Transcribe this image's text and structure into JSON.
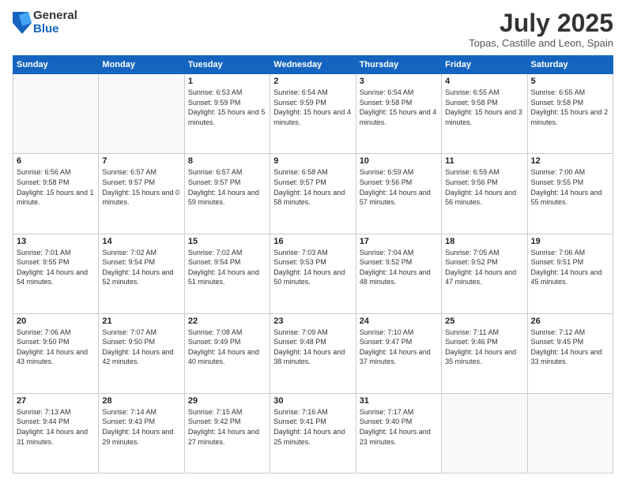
{
  "logo": {
    "general": "General",
    "blue": "Blue"
  },
  "header": {
    "month": "July 2025",
    "location": "Topas, Castille and Leon, Spain"
  },
  "weekdays": [
    "Sunday",
    "Monday",
    "Tuesday",
    "Wednesday",
    "Thursday",
    "Friday",
    "Saturday"
  ],
  "weeks": [
    [
      {
        "day": "",
        "content": ""
      },
      {
        "day": "",
        "content": ""
      },
      {
        "day": "1",
        "content": "Sunrise: 6:53 AM\nSunset: 9:59 PM\nDaylight: 15 hours and 5 minutes."
      },
      {
        "day": "2",
        "content": "Sunrise: 6:54 AM\nSunset: 9:59 PM\nDaylight: 15 hours and 4 minutes."
      },
      {
        "day": "3",
        "content": "Sunrise: 6:54 AM\nSunset: 9:58 PM\nDaylight: 15 hours and 4 minutes."
      },
      {
        "day": "4",
        "content": "Sunrise: 6:55 AM\nSunset: 9:58 PM\nDaylight: 15 hours and 3 minutes."
      },
      {
        "day": "5",
        "content": "Sunrise: 6:55 AM\nSunset: 9:58 PM\nDaylight: 15 hours and 2 minutes."
      }
    ],
    [
      {
        "day": "6",
        "content": "Sunrise: 6:56 AM\nSunset: 9:58 PM\nDaylight: 15 hours and 1 minute."
      },
      {
        "day": "7",
        "content": "Sunrise: 6:57 AM\nSunset: 9:57 PM\nDaylight: 15 hours and 0 minutes."
      },
      {
        "day": "8",
        "content": "Sunrise: 6:57 AM\nSunset: 9:57 PM\nDaylight: 14 hours and 59 minutes."
      },
      {
        "day": "9",
        "content": "Sunrise: 6:58 AM\nSunset: 9:57 PM\nDaylight: 14 hours and 58 minutes."
      },
      {
        "day": "10",
        "content": "Sunrise: 6:59 AM\nSunset: 9:56 PM\nDaylight: 14 hours and 57 minutes."
      },
      {
        "day": "11",
        "content": "Sunrise: 6:59 AM\nSunset: 9:56 PM\nDaylight: 14 hours and 56 minutes."
      },
      {
        "day": "12",
        "content": "Sunrise: 7:00 AM\nSunset: 9:55 PM\nDaylight: 14 hours and 55 minutes."
      }
    ],
    [
      {
        "day": "13",
        "content": "Sunrise: 7:01 AM\nSunset: 9:55 PM\nDaylight: 14 hours and 54 minutes."
      },
      {
        "day": "14",
        "content": "Sunrise: 7:02 AM\nSunset: 9:54 PM\nDaylight: 14 hours and 52 minutes."
      },
      {
        "day": "15",
        "content": "Sunrise: 7:02 AM\nSunset: 9:54 PM\nDaylight: 14 hours and 51 minutes."
      },
      {
        "day": "16",
        "content": "Sunrise: 7:03 AM\nSunset: 9:53 PM\nDaylight: 14 hours and 50 minutes."
      },
      {
        "day": "17",
        "content": "Sunrise: 7:04 AM\nSunset: 9:52 PM\nDaylight: 14 hours and 48 minutes."
      },
      {
        "day": "18",
        "content": "Sunrise: 7:05 AM\nSunset: 9:52 PM\nDaylight: 14 hours and 47 minutes."
      },
      {
        "day": "19",
        "content": "Sunrise: 7:06 AM\nSunset: 9:51 PM\nDaylight: 14 hours and 45 minutes."
      }
    ],
    [
      {
        "day": "20",
        "content": "Sunrise: 7:06 AM\nSunset: 9:50 PM\nDaylight: 14 hours and 43 minutes."
      },
      {
        "day": "21",
        "content": "Sunrise: 7:07 AM\nSunset: 9:50 PM\nDaylight: 14 hours and 42 minutes."
      },
      {
        "day": "22",
        "content": "Sunrise: 7:08 AM\nSunset: 9:49 PM\nDaylight: 14 hours and 40 minutes."
      },
      {
        "day": "23",
        "content": "Sunrise: 7:09 AM\nSunset: 9:48 PM\nDaylight: 14 hours and 38 minutes."
      },
      {
        "day": "24",
        "content": "Sunrise: 7:10 AM\nSunset: 9:47 PM\nDaylight: 14 hours and 37 minutes."
      },
      {
        "day": "25",
        "content": "Sunrise: 7:11 AM\nSunset: 9:46 PM\nDaylight: 14 hours and 35 minutes."
      },
      {
        "day": "26",
        "content": "Sunrise: 7:12 AM\nSunset: 9:45 PM\nDaylight: 14 hours and 33 minutes."
      }
    ],
    [
      {
        "day": "27",
        "content": "Sunrise: 7:13 AM\nSunset: 9:44 PM\nDaylight: 14 hours and 31 minutes."
      },
      {
        "day": "28",
        "content": "Sunrise: 7:14 AM\nSunset: 9:43 PM\nDaylight: 14 hours and 29 minutes."
      },
      {
        "day": "29",
        "content": "Sunrise: 7:15 AM\nSunset: 9:42 PM\nDaylight: 14 hours and 27 minutes."
      },
      {
        "day": "30",
        "content": "Sunrise: 7:16 AM\nSunset: 9:41 PM\nDaylight: 14 hours and 25 minutes."
      },
      {
        "day": "31",
        "content": "Sunrise: 7:17 AM\nSunset: 9:40 PM\nDaylight: 14 hours and 23 minutes."
      },
      {
        "day": "",
        "content": ""
      },
      {
        "day": "",
        "content": ""
      }
    ]
  ]
}
